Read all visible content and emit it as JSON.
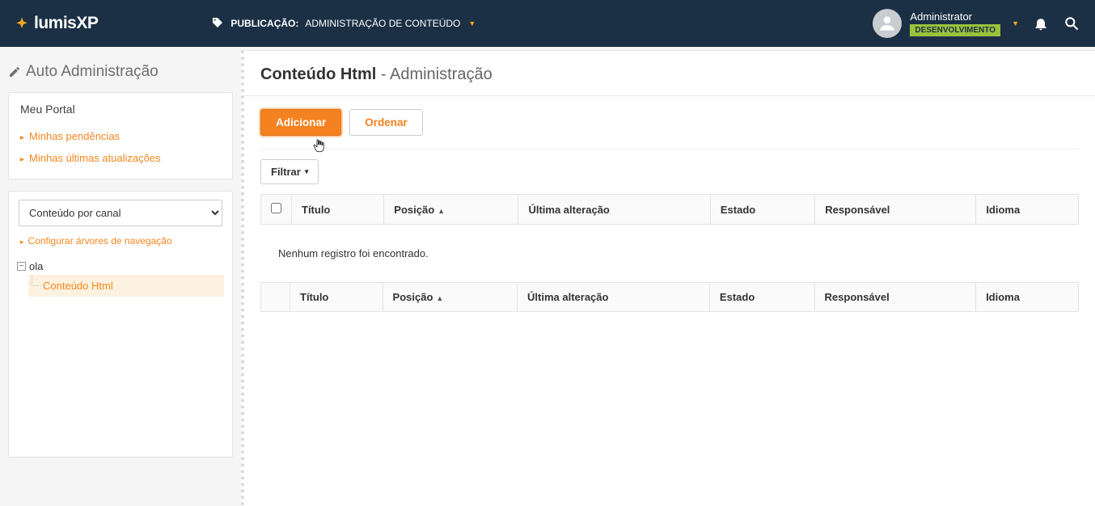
{
  "topbar": {
    "logo_text_a": "lumis",
    "logo_text_b": "XP",
    "publicacao_label": "PUBLICAÇÃO:",
    "publicacao_value": "ADMINISTRAÇÃO DE CONTEÚDO",
    "user_name": "Administrator",
    "env_badge": "DESENVOLVIMENTO"
  },
  "sidebar": {
    "auto_admin": "Auto Administração",
    "meu_portal": {
      "title": "Meu Portal",
      "links": [
        "Minhas pendências",
        "Minhas últimas atualizações"
      ]
    },
    "channel_select": {
      "selected": "Conteúdo por canal",
      "options": [
        "Conteúdo por canal"
      ]
    },
    "config_link": "Configurar árvores de navegação",
    "tree": {
      "root": "ola",
      "child": "Conteúdo Html"
    }
  },
  "main": {
    "title_bold": "Conteúdo Html",
    "title_light": " - Administração",
    "buttons": {
      "add": "Adicionar",
      "order": "Ordenar"
    },
    "filter": "Filtrar",
    "columns": {
      "titulo": "Título",
      "posicao": "Posição",
      "ultima": "Última alteração",
      "estado": "Estado",
      "responsavel": "Responsável",
      "idioma": "Idioma"
    },
    "empty": "Nenhum registro foi encontrado."
  }
}
